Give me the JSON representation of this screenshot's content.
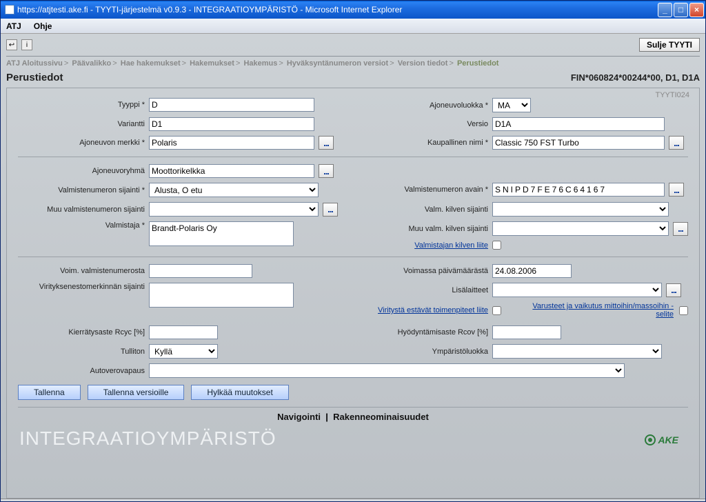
{
  "window": {
    "title": "https://atjtesti.ake.fi - TYYTI-järjestelmä v0.9.3 - INTEGRAATIOYMPÄRISTÖ - Microsoft Internet Explorer"
  },
  "menubar": {
    "items": [
      "ATJ",
      "Ohje"
    ]
  },
  "toolbar": {
    "close_label": "Sulje TYYTI"
  },
  "breadcrumbs": [
    "ATJ Aloitussivu",
    "Päävalikko",
    "Hae hakemukset",
    "Hakemukset",
    "Hakemus",
    "Hyväksyntänumeron versiot",
    "Version tiedot",
    "Perustiedot"
  ],
  "page": {
    "title": "Perustiedot",
    "code_right": "FIN*060824*00244*00, D1, D1A",
    "screen_id": "TYYTI024"
  },
  "form": {
    "tyyppi": {
      "label": "Tyyppi *",
      "value": "D"
    },
    "variantti": {
      "label": "Variantti",
      "value": "D1"
    },
    "merkki": {
      "label": "Ajoneuvon merkki *",
      "value": "Polaris"
    },
    "ajoneuvoluokka": {
      "label": "Ajoneuvoluokka *",
      "value": "MA"
    },
    "versio": {
      "label": "Versio",
      "value": "D1A"
    },
    "kaupallinen": {
      "label": "Kaupallinen nimi *",
      "value": "Classic 750 FST Turbo"
    },
    "ajoneuvoryhma": {
      "label": "Ajoneuvoryhmä",
      "value": "Moottorikelkka"
    },
    "valm_sijainti": {
      "label": "Valmistenumeron sijainti *",
      "value": "Alusta, O etu"
    },
    "muu_valm_sijainti": {
      "label": "Muu valmistenumeron sijainti",
      "value": ""
    },
    "valmistaja": {
      "label": "Valmistaja *",
      "value": "Brandt-Polaris Oy"
    },
    "valm_avain": {
      "label": "Valmistenumeron avain *",
      "value": "SNIPD7FE76C64167"
    },
    "kilven_sijainti": {
      "label": "Valm. kilven sijainti",
      "value": ""
    },
    "muu_kilven_sijainti": {
      "label": "Muu valm. kilven sijainti",
      "value": ""
    },
    "kilven_liite": {
      "label": "Valmistajan kilven liite"
    },
    "voim_valm": {
      "label": "Voim. valmistenumerosta",
      "value": ""
    },
    "virityksenesto": {
      "label": "Virityksenestomerkinnän sijainti",
      "value": ""
    },
    "voimassa_pvm": {
      "label": "Voimassa päivämäärästä",
      "value": "24.08.2006"
    },
    "lisalaitteet": {
      "label": "Lisälaitteet",
      "value": ""
    },
    "viritys_liite": {
      "label": "Viritystä estävät toimenpiteet liite"
    },
    "varusteet_selite": {
      "label": "Varusteet ja vaikutus mittoihin/massoihin -selite"
    },
    "rcyc": {
      "label": "Kierrätysaste Rcyc [%]",
      "value": ""
    },
    "tulliton": {
      "label": "Tulliton",
      "value": "Kyllä"
    },
    "autoverovapaus": {
      "label": "Autoverovapaus",
      "value": ""
    },
    "rcov": {
      "label": "Hyödyntämisaste Rcov [%]",
      "value": ""
    },
    "ymparistoluokka": {
      "label": "Ympäristöluokka",
      "value": ""
    }
  },
  "buttons": {
    "save": "Tallenna",
    "save_versions": "Tallenna versioille",
    "reject": "Hylkää muutokset"
  },
  "navlinks": {
    "nav": "Navigointi",
    "rakenne": "Rakenneominaisuudet"
  },
  "env": {
    "label": "INTEGRAATIOYMPÄRISTÖ",
    "logo": "AKE"
  }
}
